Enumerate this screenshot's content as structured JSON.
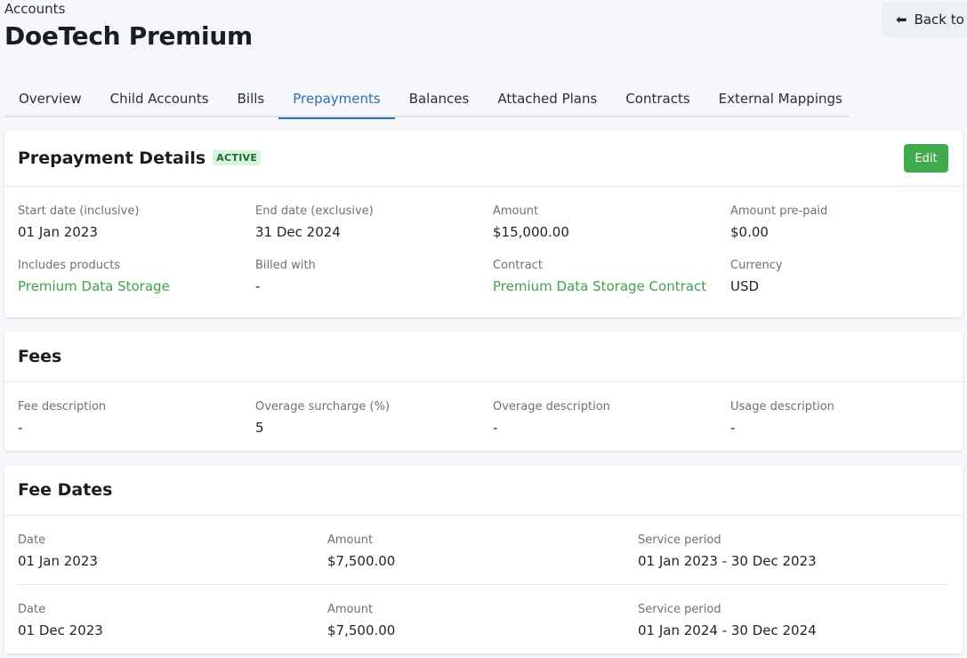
{
  "header": {
    "breadcrumb": "Accounts",
    "title": "DoeTech Premium",
    "back_label": "Back to"
  },
  "tabs": [
    {
      "label": "Overview"
    },
    {
      "label": "Child Accounts"
    },
    {
      "label": "Bills"
    },
    {
      "label": "Prepayments",
      "active": true
    },
    {
      "label": "Balances"
    },
    {
      "label": "Attached Plans"
    },
    {
      "label": "Contracts"
    },
    {
      "label": "External Mappings"
    }
  ],
  "prepayment": {
    "title": "Prepayment Details",
    "status": "ACTIVE",
    "edit_label": "Edit",
    "fields": [
      {
        "label": "Start date (inclusive)",
        "value": "01 Jan 2023"
      },
      {
        "label": "End date (exclusive)",
        "value": "31 Dec 2024"
      },
      {
        "label": "Amount",
        "value": "$15,000.00"
      },
      {
        "label": "Amount pre-paid",
        "value": "$0.00"
      },
      {
        "label": "Includes products",
        "value": "Premium Data Storage"
      },
      {
        "label": "Billed with",
        "value": "-"
      },
      {
        "label": "Contract",
        "value": "Premium Data Storage Contract"
      },
      {
        "label": "Currency",
        "value": "USD"
      }
    ]
  },
  "fees": {
    "title": "Fees",
    "fields": [
      {
        "label": "Fee description",
        "value": "-"
      },
      {
        "label": "Overage surcharge (%)",
        "value": "5"
      },
      {
        "label": "Overage description",
        "value": "-"
      },
      {
        "label": "Usage description",
        "value": "-"
      }
    ]
  },
  "fee_dates": {
    "title": "Fee Dates",
    "labels": {
      "date": "Date",
      "amount": "Amount",
      "service_period": "Service period"
    },
    "rows": [
      {
        "date": "01 Jan 2023",
        "amount": "$7,500.00",
        "service_period": "01 Jan 2023 - 30 Dec 2023"
      },
      {
        "date": "01 Dec 2023",
        "amount": "$7,500.00",
        "service_period": "01 Jan 2024 - 30 Dec 2024"
      }
    ]
  },
  "colors": {
    "accent_tab": "#2f6fad",
    "link_green": "#3fa14c",
    "edit_green": "#3fab4d",
    "badge_bg": "#d6f5dc"
  }
}
